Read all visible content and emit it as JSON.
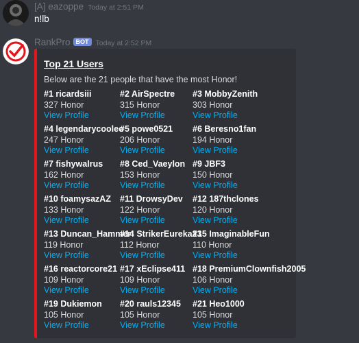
{
  "messages": [
    {
      "author": "[A] eazoppe",
      "timestamp": "Today at 2:51 PM",
      "content": "n!lb"
    },
    {
      "author": "RankPro",
      "bot_tag": "BOT",
      "timestamp": "Today at 2:52 PM"
    }
  ],
  "embed": {
    "accent_color": "#e3161c",
    "title": "Top 21 Users",
    "description": "Below are the 21 people that have the most Honor!",
    "link_label": "View Profile",
    "fields": [
      {
        "name": "#1 ricardsiii",
        "value": "327 Honor"
      },
      {
        "name": "#2 AirSpectre",
        "value": "315 Honor"
      },
      {
        "name": "#3 MobbyZenith",
        "value": "303 Honor"
      },
      {
        "name": "#4 legendarycooleo",
        "value": "247 Honor"
      },
      {
        "name": "#5 powe0521",
        "value": "206 Honor"
      },
      {
        "name": "#6 Beresno1fan",
        "value": "194 Honor"
      },
      {
        "name": "#7 fishywalrus",
        "value": "162 Honor"
      },
      {
        "name": "#8 Ced_Vaeylon",
        "value": "153 Honor"
      },
      {
        "name": "#9 JBF3",
        "value": "150 Honor"
      },
      {
        "name": "#10 foamysazAZ",
        "value": "133 Honor"
      },
      {
        "name": "#11 DrowsyDev",
        "value": "122 Honor"
      },
      {
        "name": "#12 187thclones",
        "value": "120 Honor"
      },
      {
        "name": "#13 Duncan_Hammer",
        "value": "119 Honor"
      },
      {
        "name": "#14 StrikerEureka23",
        "value": "112 Honor"
      },
      {
        "name": "#15 ImaginableFun",
        "value": "110 Honor"
      },
      {
        "name": "#16 reactorcore21",
        "value": "109 Honor"
      },
      {
        "name": "#17 xEclipse411",
        "value": "109 Honor"
      },
      {
        "name": "#18 PremiumClownfish2005",
        "value": "106 Honor"
      },
      {
        "name": "#19 Dukiemon",
        "value": "105 Honor"
      },
      {
        "name": "#20 rauls12345",
        "value": "105 Honor"
      },
      {
        "name": "#21 Heo1000",
        "value": "105 Honor"
      }
    ]
  }
}
